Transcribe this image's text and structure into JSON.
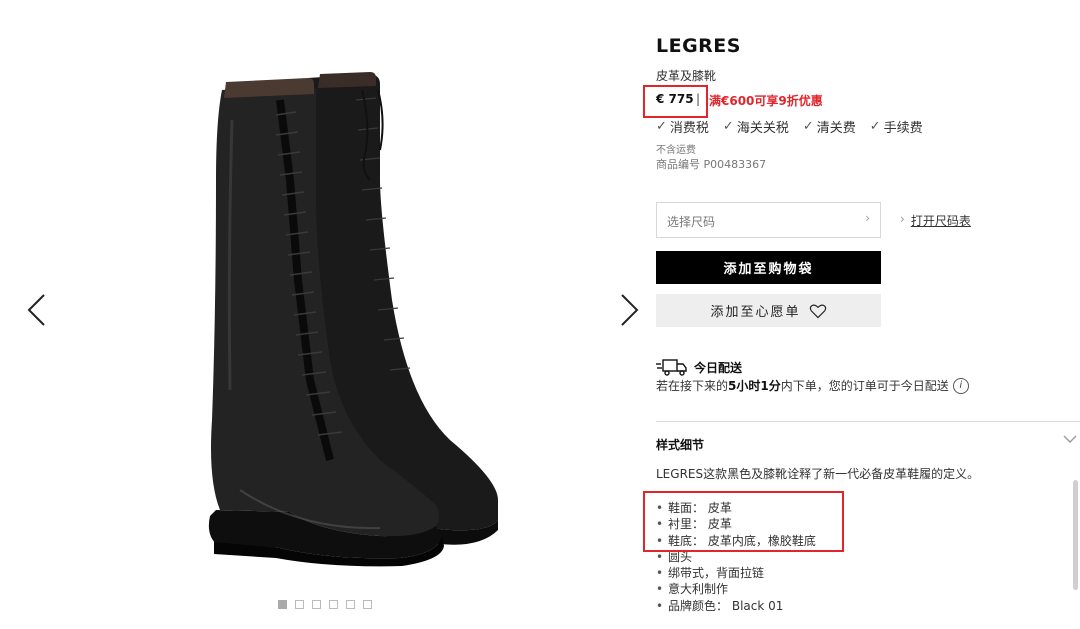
{
  "gallery": {
    "prev_icon": "chevron-left-icon",
    "next_icon": "chevron-right-icon",
    "thumbnail_count": 6,
    "active_thumbnail": 1
  },
  "product": {
    "brand": "LEGRES",
    "name": "皮革及膝靴",
    "price": "€ 775",
    "separator": "|",
    "promo": "满€600可享9折优惠",
    "fees": [
      "消费税",
      "海关关税",
      "清关费",
      "手续费"
    ],
    "shipping_note": "不含运费",
    "sku_label": "商品编号",
    "sku": "P00483367"
  },
  "purchase": {
    "size_placeholder": "选择尺码",
    "size_chart": "打开尺码表",
    "add_to_bag": "添加至购物袋",
    "add_to_wishlist": "添加至心愿单"
  },
  "delivery": {
    "title": "今日配送",
    "desc_prefix": "若在接下来的",
    "time_hours": "5小时",
    "time_minutes": "1分",
    "desc_suffix": "内下单，您的订单可于今日配送",
    "info_icon": "i"
  },
  "details": {
    "title": "样式细节",
    "description": "LEGRES这款黑色及膝靴诠释了新一代必备皮革鞋履的定义。",
    "specs": [
      {
        "label": "鞋面：",
        "value": "皮革"
      },
      {
        "label": "衬里：",
        "value": "皮革"
      },
      {
        "label": "鞋底：",
        "value": "皮革内底，橡胶鞋底"
      },
      {
        "label": "圆头",
        "value": ""
      },
      {
        "label": "绑带式，背面拉链",
        "value": ""
      },
      {
        "label": "意大利制作",
        "value": ""
      },
      {
        "label": "品牌颜色：",
        "value": "Black 01"
      }
    ]
  },
  "colors": {
    "accent_red": "#e0252b",
    "button_black": "#000000",
    "button_grey": "#eeeeee"
  }
}
